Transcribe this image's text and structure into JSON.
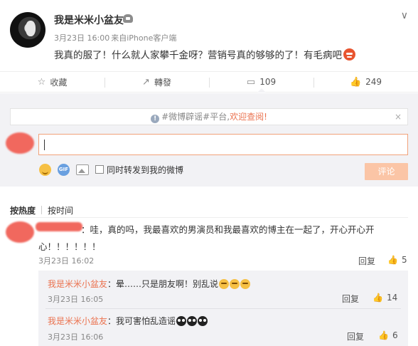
{
  "post": {
    "author": "我是米米小盆友",
    "date": "3月23日 16:00",
    "source": "来自iPhone客户端",
    "text": "我真的服了！什么就人家攀千金呀？营销号真的够够的了！有毛病吧",
    "emoji_icon": "angry-face-icon"
  },
  "actions": {
    "favorite_label": "收藏",
    "repost_label": "轉發",
    "comment_count": "109",
    "like_count": "249"
  },
  "notice": {
    "prefix": "#微博辟谣#平台,",
    "link": "欢迎查阅!",
    "close": "×"
  },
  "composer": {
    "placeholder": "",
    "checkbox_label": "同时转发到我的微博",
    "submit_label": "评论",
    "tools": [
      "emoji-icon",
      "gif-icon",
      "image-icon"
    ]
  },
  "sort": {
    "hot": "按热度",
    "time": "按时间"
  },
  "comments": [
    {
      "text_line1": "：哇，真的吗，我最喜欢的男演员和我最喜欢的博主在一起了，开心开心开",
      "text_line2": "心！！！！！！",
      "time": "3月23日 16:02",
      "reply_label": "回复",
      "likes": "5",
      "replies": [
        {
          "name": "我是米米小盆友",
          "text": "：晕……只是朋友啊！别乱说",
          "time": "3月23日 16:05",
          "reply_label": "回复",
          "likes": "14"
        },
        {
          "name": "我是米米小盆友",
          "text": "：我可害怕乱造谣",
          "time": "3月23日 16:06",
          "reply_label": "回复",
          "likes": "6"
        }
      ]
    }
  ],
  "colors": {
    "accent": "#eb7350",
    "redaction": "#f1685e",
    "panel": "#f2f2f5"
  }
}
